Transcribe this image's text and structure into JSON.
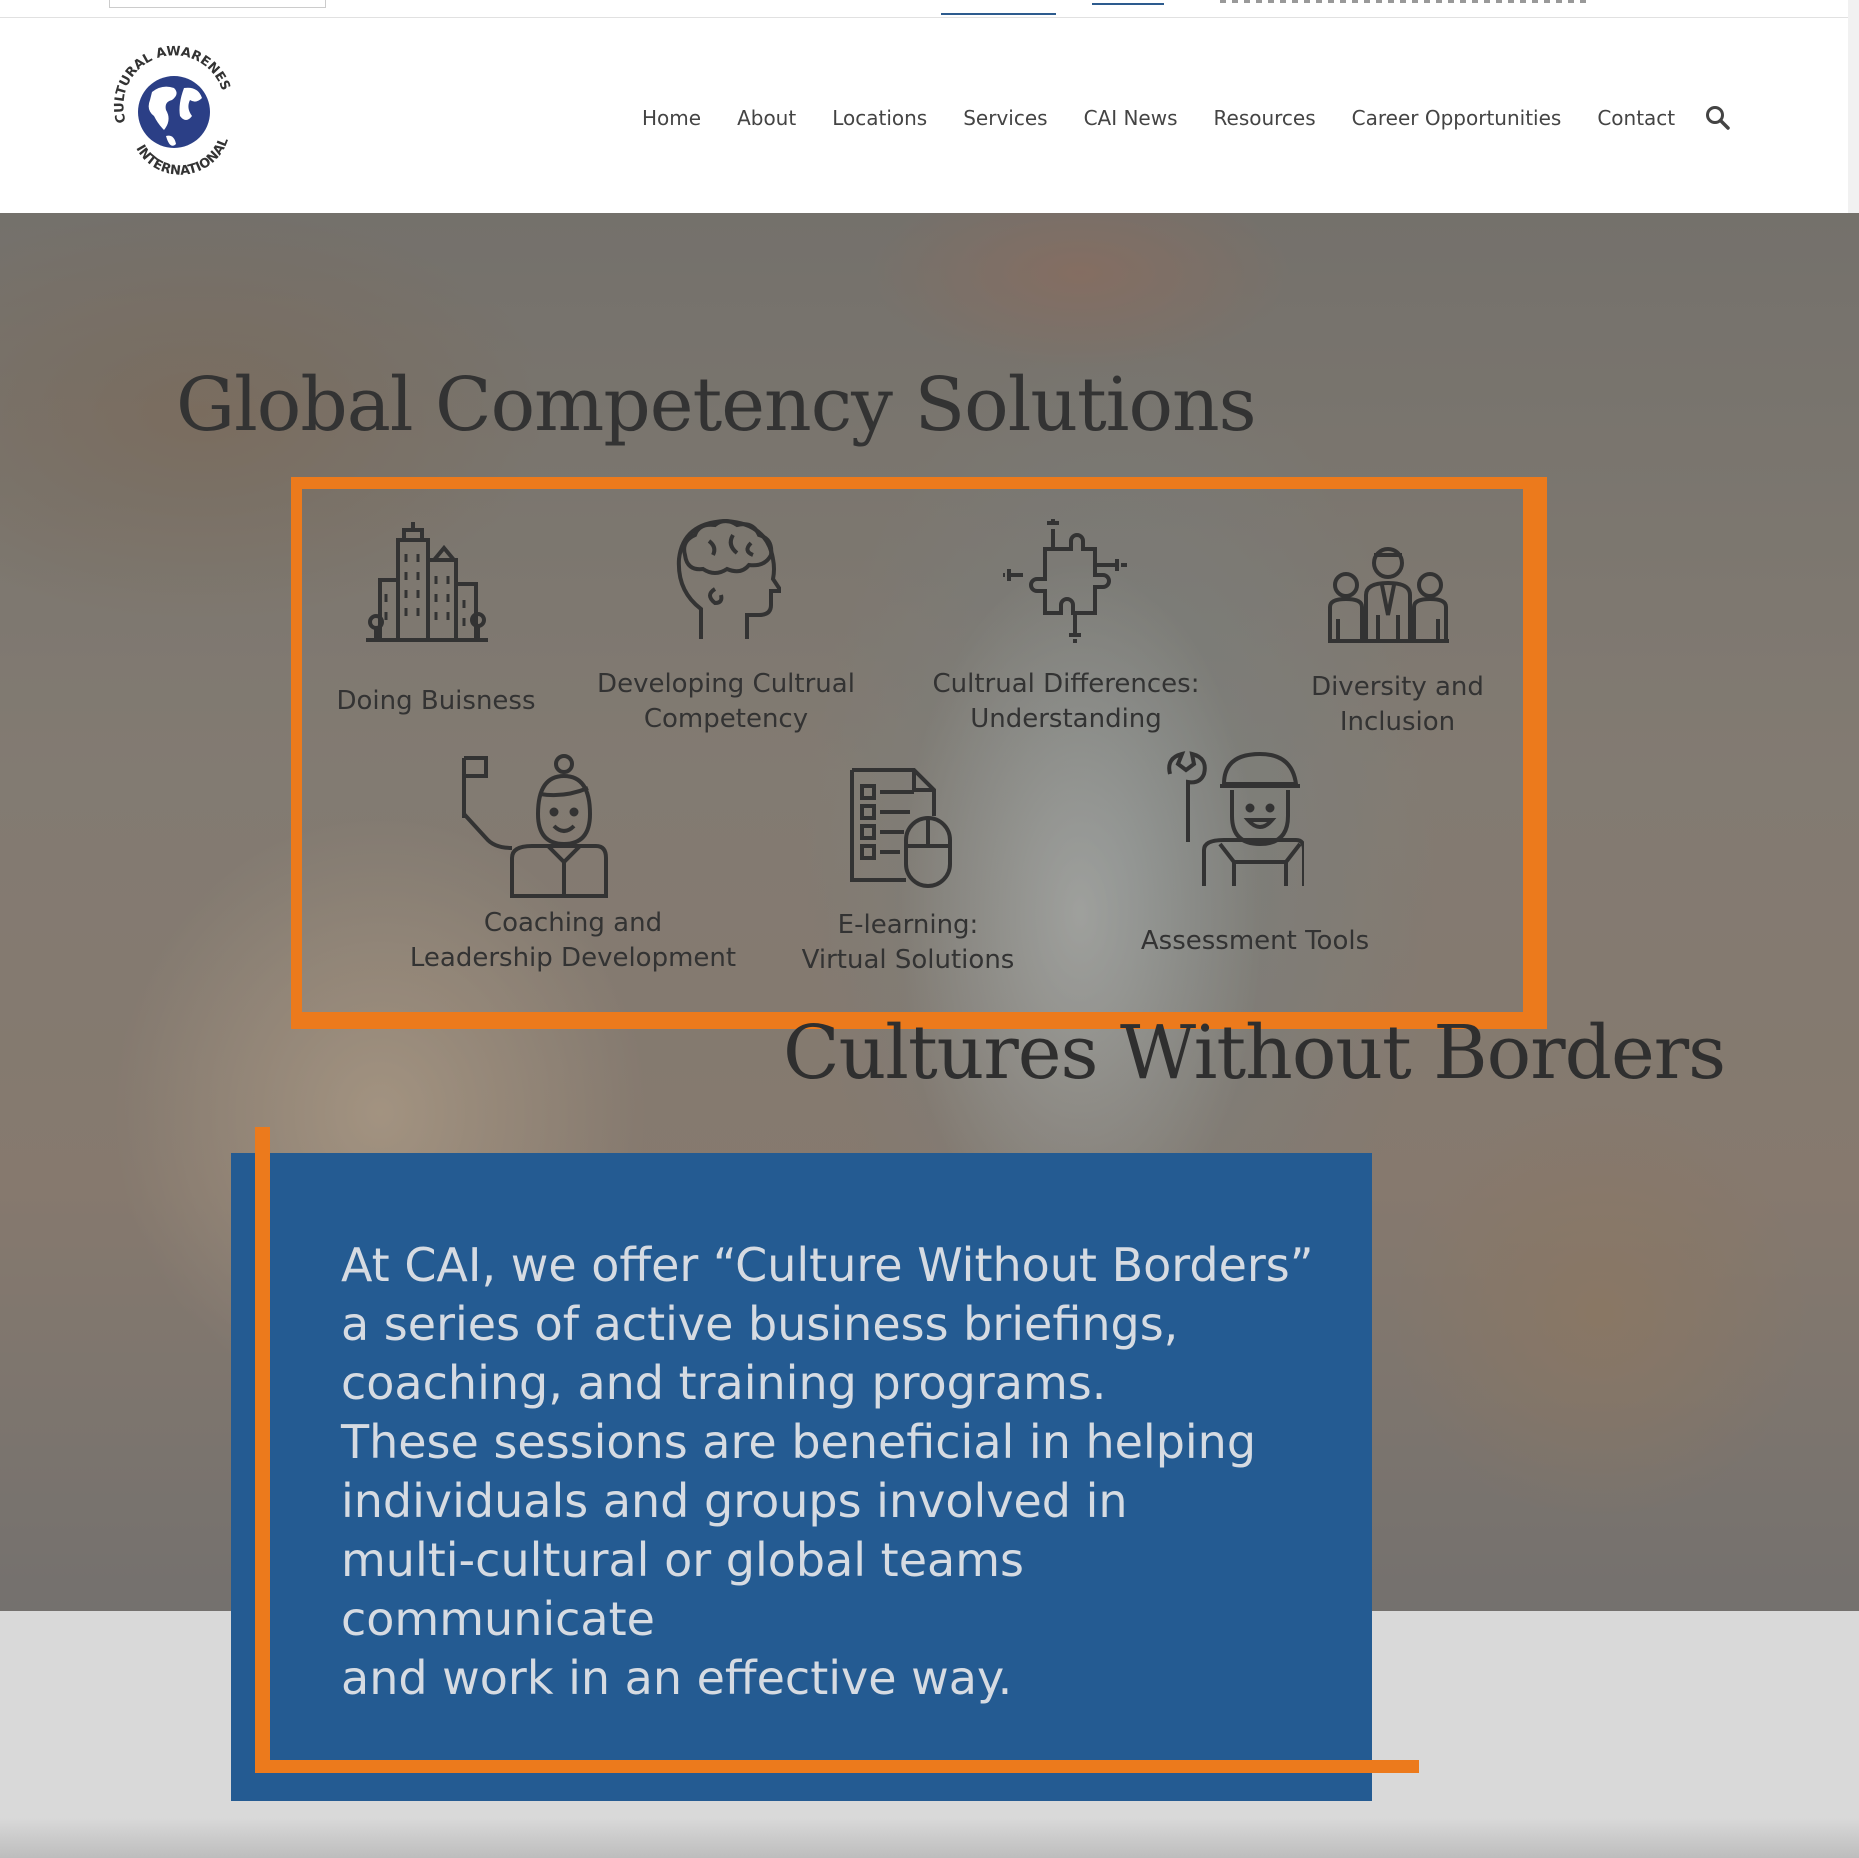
{
  "nav": {
    "items": [
      "Home",
      "About",
      "Locations",
      "Services",
      "CAI News",
      "Resources",
      "Career Opportunities",
      "Contact"
    ]
  },
  "logo": {
    "text_top": "CULTURAL AWARENESS",
    "text_bottom": "INTERNATIONAL"
  },
  "hero": {
    "title": "Global Competency Solutions",
    "services": [
      {
        "label": "Doing Buisness",
        "icon": "city-buildings-icon"
      },
      {
        "label": "Developing Cultrual\nCompetency",
        "icon": "head-brain-icon"
      },
      {
        "label": "Cultrual Differences:\nUnderstanding",
        "icon": "puzzle-pieces-icon"
      },
      {
        "label": "Diversity and\nInclusion",
        "icon": "group-people-icon"
      },
      {
        "label": "Coaching and\nLeadership Development",
        "icon": "leader-flag-icon"
      },
      {
        "label": "E-learning:\nVirtual Solutions",
        "icon": "document-mouse-icon"
      },
      {
        "label": "Assessment Tools",
        "icon": "worker-wrench-icon"
      }
    ],
    "subtitle": "Cultures Without Borders",
    "body": "At CAI, we offer “Culture Without Borders”\na series of active business briefings,\ncoaching, and training programs.\nThese sessions are beneficial in helping\nindividuals and groups involved in\nmulti-cultural or global teams communicate\nand work in an effective way."
  },
  "colors": {
    "accent_orange": "#ec7a1c",
    "box_blue": "#245b92",
    "logo_blue": "#2b3f86"
  }
}
